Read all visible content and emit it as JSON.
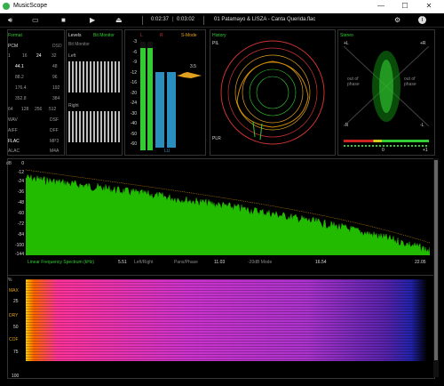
{
  "window": {
    "title": "MusicScope",
    "min": "—",
    "max": "☐",
    "close": "✕"
  },
  "toolbar": {
    "time_elapsed": "0:02:37",
    "time_total": "0:03:02",
    "file": "01 Patamayo & LISZA - Canta Querida.flac"
  },
  "format_panel": {
    "title": "Format",
    "pcm": "PCM",
    "dsd": "DSD",
    "bits": [
      "1",
      "16",
      "24",
      "32"
    ],
    "rates_left": [
      "44.1",
      "88.2",
      "176.4",
      "352.8"
    ],
    "rates_right": [
      "48",
      "96",
      "192",
      "384"
    ],
    "more_rates": [
      "64",
      "128",
      "256",
      "512"
    ],
    "types_left": [
      "WAV",
      "AIFF",
      "FLAC",
      "ALAC"
    ],
    "types_right": [
      "DSF",
      "DFF",
      "MP3",
      "M4A"
    ]
  },
  "levels_panel": {
    "title": "Levels",
    "mode": "Bit Monitor",
    "sub": "Bit Monitor",
    "left": "Left",
    "right": "Right"
  },
  "meter_panel": {
    "title": "S-Mode",
    "left_mark": "L",
    "right_mark": "R",
    "value": "3.5",
    "scale": [
      "-3",
      "-6",
      "-9",
      "-12",
      "-16",
      "-20",
      "-24",
      "-30",
      "-40",
      "-50",
      "-60"
    ],
    "bottom": "LU"
  },
  "history_panel": {
    "title": "History",
    "pil": "PIL",
    "plr": "PLR"
  },
  "stereo_panel": {
    "title": "Stereo",
    "l_top": "+L",
    "r_top": "+R",
    "l_bot": "-R",
    "r_bot": "-L",
    "oop1": "out of phase",
    "oop2": "out of phase",
    "c0": "0",
    "c1": "+1"
  },
  "spectrum": {
    "db_label": "dB",
    "ticks": [
      "0",
      "-12",
      "-24",
      "-36",
      "-48",
      "-60",
      "-72",
      "-84",
      "-100",
      "-144"
    ],
    "caption": "Linear Frequency Spectrum (kHz)",
    "x_ticks": [
      "5.51",
      "11.03",
      "16.54",
      "22.05"
    ],
    "opt1": "Left/Right",
    "opt2": "Pans/Phase",
    "opt3": "-20dB Mode"
  },
  "sonogram": {
    "pct": "%",
    "labels": [
      "MAX",
      "25",
      "DRY",
      "50",
      "COF",
      "75",
      "100"
    ]
  },
  "colors": {
    "accent": "#33cc33",
    "spectrum": "#22bb00",
    "peak": "#cc8800"
  }
}
